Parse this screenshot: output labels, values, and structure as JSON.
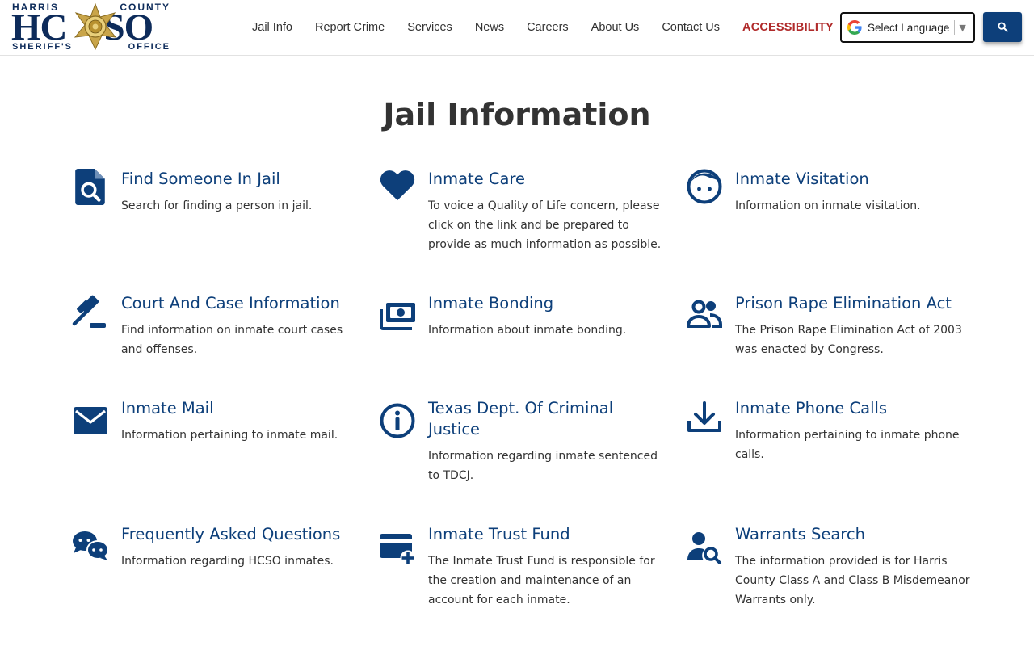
{
  "logo": {
    "top_left": "HARRIS",
    "top_right": "COUNTY",
    "letters_left": "HC",
    "letters_right": "SO",
    "bottom_left": "SHERIFF'S",
    "bottom_right": "OFFICE"
  },
  "nav": {
    "items": [
      "Jail Info",
      "Report Crime",
      "Services",
      "News",
      "Careers",
      "About Us",
      "Contact Us"
    ],
    "accessibility": "ACCESSIBILITY"
  },
  "language": {
    "label": "Select Language"
  },
  "page_title": "Jail Information",
  "colors": {
    "brand": "#0d3f7a",
    "accessibility": "#b02a2a"
  },
  "items": [
    {
      "title": "Find Someone In Jail",
      "desc": "Search for finding a person in jail.",
      "icon": "file-search-icon"
    },
    {
      "title": "Inmate Care",
      "desc": "To voice a Quality of Life concern, please click on the link and be prepared to provide as much information as possible.",
      "icon": "heart-icon"
    },
    {
      "title": "Inmate Visitation",
      "desc": "Information on inmate visitation.",
      "icon": "face-icon"
    },
    {
      "title": "Court And Case Information",
      "desc": "Find information on inmate court cases and offenses.",
      "icon": "gavel-icon"
    },
    {
      "title": "Inmate Bonding",
      "desc": "Information about inmate bonding.",
      "icon": "money-icon"
    },
    {
      "title": "Prison Rape Elimination Act",
      "desc": "The Prison Rape Elimination Act of 2003 was enacted by Congress.",
      "icon": "users-icon"
    },
    {
      "title": "Inmate Mail",
      "desc": "Information pertaining to inmate mail.",
      "icon": "envelope-icon"
    },
    {
      "title": "Texas Dept. Of Criminal Justice",
      "desc": "Information regarding inmate sentenced to TDCJ.",
      "icon": "info-icon"
    },
    {
      "title": "Inmate Phone Calls",
      "desc": "Information pertaining to inmate phone calls.",
      "icon": "download-icon"
    },
    {
      "title": "Frequently Asked Questions",
      "desc": "Information regarding HCSO inmates.",
      "icon": "chat-icon"
    },
    {
      "title": "Inmate Trust Fund",
      "desc": "The Inmate Trust Fund is responsible for the creation and maintenance of an account for each inmate.",
      "icon": "card-plus-icon"
    },
    {
      "title": "Warrants Search",
      "desc": "The information provided is for Harris County Class A and Class B Misdemeanor Warrants only.",
      "icon": "user-search-icon"
    }
  ]
}
